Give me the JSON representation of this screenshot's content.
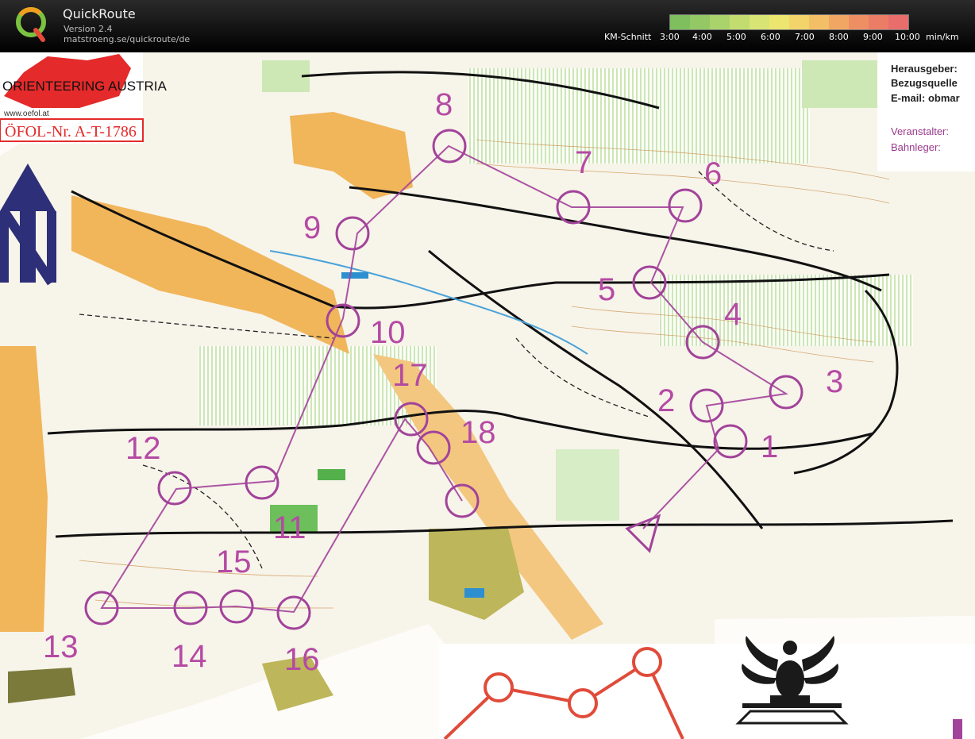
{
  "app": {
    "title": "QuickRoute",
    "version": "Version 2.4",
    "url": "matstroeng.se/quickroute/de"
  },
  "pace_scale": {
    "label": "KM-Schnitt",
    "ticks": [
      "3:00",
      "4:00",
      "5:00",
      "6:00",
      "7:00",
      "8:00",
      "9:00",
      "10:00"
    ],
    "unit": "min/km",
    "colors": [
      "#7fbf5e",
      "#93c865",
      "#aad36b",
      "#c2dc70",
      "#d8e474",
      "#ece56f",
      "#f2d46a",
      "#f3bf66",
      "#f1a763",
      "#ee8f63",
      "#eb7d66",
      "#e86d6b"
    ]
  },
  "map": {
    "header_logo_text": "ORIENTEERING AUSTRIA",
    "website": "www.oefol.at",
    "oefol_number": "ÖFOL-Nr. A-T-1786",
    "publisher_lines": [
      "Herausgeber:",
      "Bezugsquelle",
      "E-mail: obmar"
    ],
    "organizer_lines": [
      "Veranstalter:",
      "Bahnleger:"
    ],
    "controls": [
      "1",
      "2",
      "3",
      "4",
      "5",
      "6",
      "7",
      "8",
      "9",
      "10",
      "11",
      "12",
      "13",
      "14",
      "15",
      "16",
      "17",
      "18"
    ]
  }
}
